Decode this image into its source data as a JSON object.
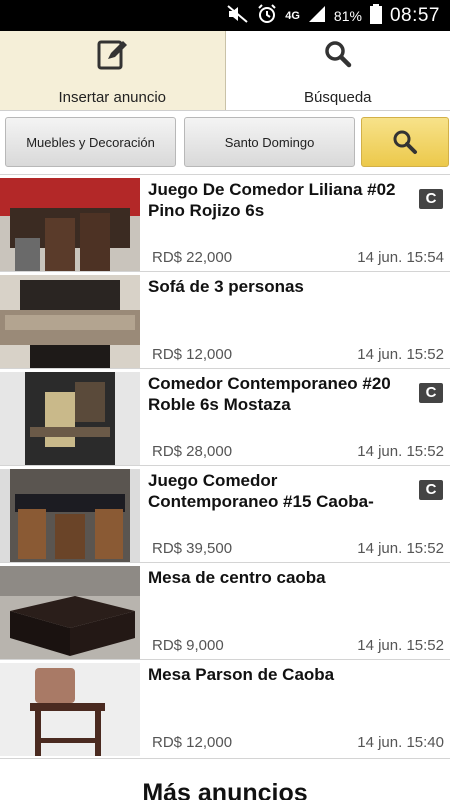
{
  "status_bar": {
    "time": "08:57",
    "battery": "81%",
    "network": "4G"
  },
  "tabs": [
    {
      "label": "Insertar anuncio",
      "icon": "edit-icon",
      "active": true
    },
    {
      "label": "Búsqueda",
      "icon": "search-icon",
      "active": false
    }
  ],
  "filters": {
    "category": "Muebles y Decoración",
    "location": "Santo Domingo"
  },
  "listings": [
    {
      "title": "Juego De Comedor Liliana #02 Pino Rojizo 6s",
      "price": "RD$ 22,000",
      "date": "14 jun. 15:54",
      "badge": "C"
    },
    {
      "title": "Sofá de 3 personas",
      "price": "RD$ 12,000",
      "date": "14 jun. 15:52",
      "badge": ""
    },
    {
      "title": "Comedor Contemporaneo #20 Roble 6s Mostaza",
      "price": "RD$ 28,000",
      "date": "14 jun. 15:52",
      "badge": "C"
    },
    {
      "title": "Juego Comedor Contemporaneo #15 Caoba-",
      "price": "RD$ 39,500",
      "date": "14 jun. 15:52",
      "badge": "C"
    },
    {
      "title": "Mesa de centro caoba",
      "price": "RD$ 9,000",
      "date": "14 jun. 15:52",
      "badge": ""
    },
    {
      "title": "Mesa Parson de Caoba",
      "price": "RD$ 12,000",
      "date": "14 jun. 15:40",
      "badge": ""
    }
  ],
  "more_label": "Más anuncios",
  "colors": {
    "active_tab": "#f5efd8",
    "search_button": "#ecc94b",
    "badge": "#444444"
  }
}
